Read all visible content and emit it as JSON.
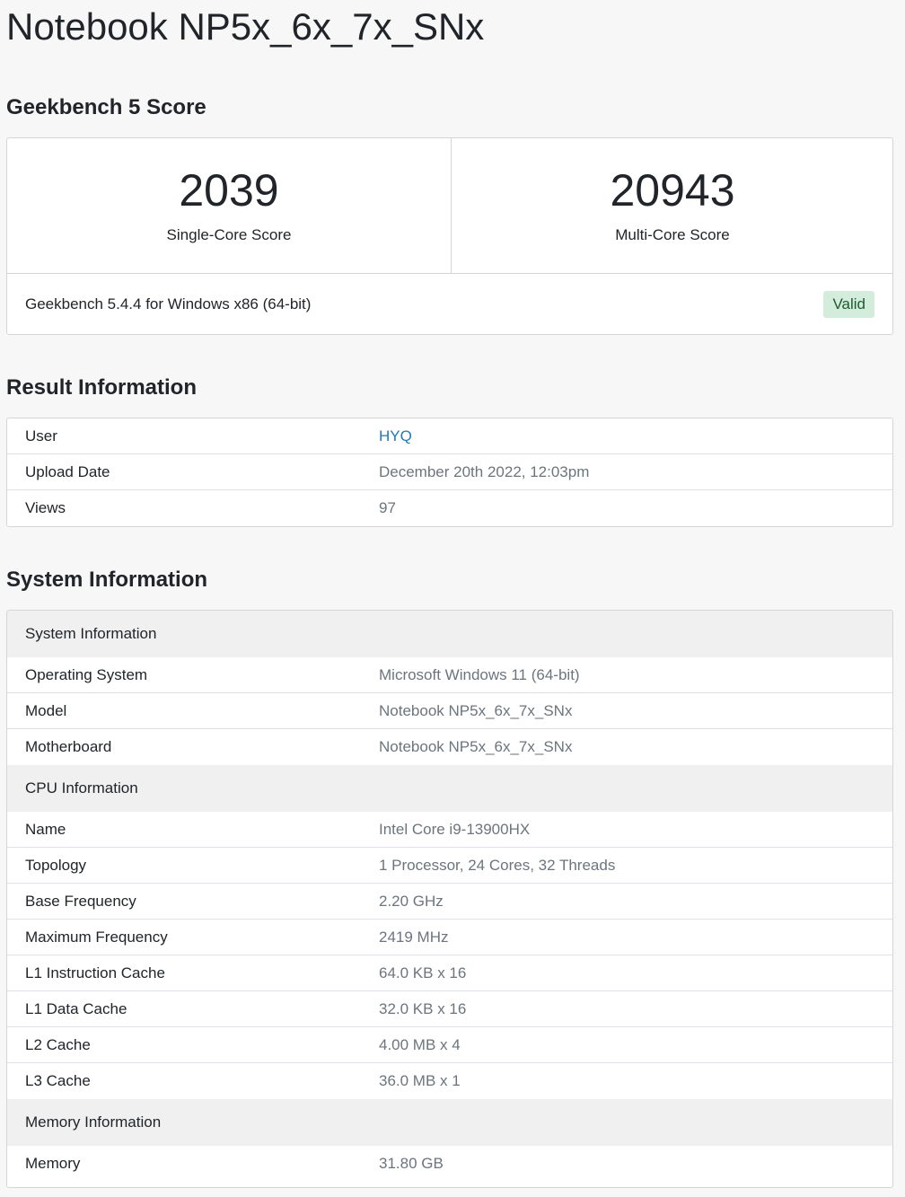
{
  "page_title": "Notebook NP5x_6x_7x_SNx",
  "score_section": {
    "heading": "Geekbench 5 Score",
    "single_core": {
      "value": "2039",
      "label": "Single-Core Score"
    },
    "multi_core": {
      "value": "20943",
      "label": "Multi-Core Score"
    },
    "version": "Geekbench 5.4.4 for Windows x86 (64-bit)",
    "status": "Valid"
  },
  "result_section": {
    "heading": "Result Information",
    "rows": [
      {
        "key": "User",
        "value": "HYQ"
      },
      {
        "key": "Upload Date",
        "value": "December 20th 2022, 12:03pm"
      },
      {
        "key": "Views",
        "value": "97"
      }
    ]
  },
  "system_section": {
    "heading": "System Information",
    "groups": [
      {
        "title": "System Information",
        "rows": [
          {
            "key": "Operating System",
            "value": "Microsoft Windows 11 (64-bit)"
          },
          {
            "key": "Model",
            "value": "Notebook NP5x_6x_7x_SNx"
          },
          {
            "key": "Motherboard",
            "value": "Notebook NP5x_6x_7x_SNx"
          }
        ]
      },
      {
        "title": "CPU Information",
        "rows": [
          {
            "key": "Name",
            "value": "Intel Core i9-13900HX"
          },
          {
            "key": "Topology",
            "value": "1 Processor, 24 Cores, 32 Threads"
          },
          {
            "key": "Base Frequency",
            "value": "2.20 GHz"
          },
          {
            "key": "Maximum Frequency",
            "value": "2419 MHz"
          },
          {
            "key": "L1 Instruction Cache",
            "value": "64.0 KB x 16"
          },
          {
            "key": "L1 Data Cache",
            "value": "32.0 KB x 16"
          },
          {
            "key": "L2 Cache",
            "value": "4.00 MB x 4"
          },
          {
            "key": "L3 Cache",
            "value": "36.0 MB x 1"
          }
        ]
      },
      {
        "title": "Memory Information",
        "rows": [
          {
            "key": "Memory",
            "value": "31.80 GB"
          }
        ]
      }
    ]
  },
  "colors": {
    "link": "#1f7ab8",
    "valid_badge_bg": "#d3ecdb",
    "valid_badge_text": "#1f5a30"
  }
}
